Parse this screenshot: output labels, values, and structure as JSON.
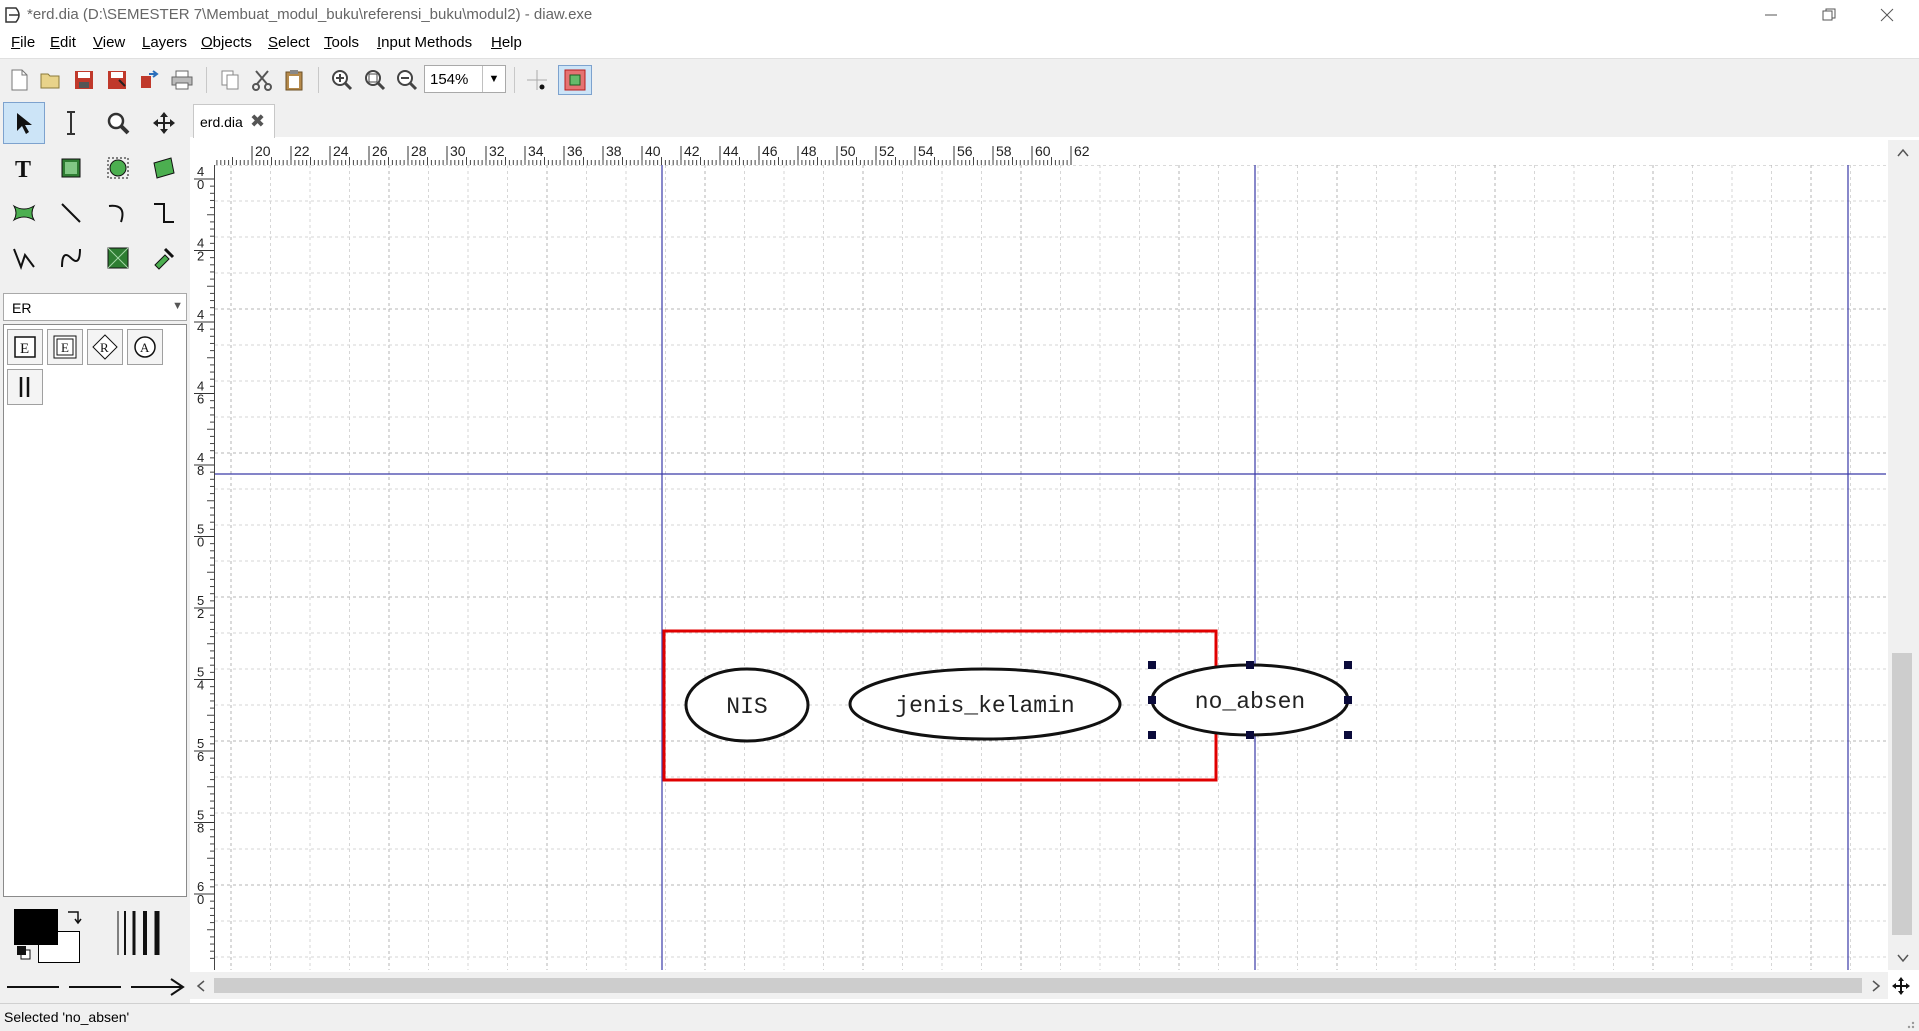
{
  "window": {
    "title": "*erd.dia (D:\\SEMESTER 7\\Membuat_modul_buku\\referensi_buku\\modul2) - diaw.exe",
    "controls": [
      "minimize",
      "restore",
      "close"
    ]
  },
  "menu": {
    "items": [
      {
        "label": "File",
        "accel": "F"
      },
      {
        "label": "Edit",
        "accel": "E"
      },
      {
        "label": "View",
        "accel": "V"
      },
      {
        "label": "Layers",
        "accel": "L"
      },
      {
        "label": "Objects",
        "accel": "O"
      },
      {
        "label": "Select",
        "accel": "S"
      },
      {
        "label": "Tools",
        "accel": "T"
      },
      {
        "label": "Input Methods",
        "accel": "I"
      },
      {
        "label": "Help",
        "accel": "H"
      }
    ]
  },
  "toolbar": {
    "zoom": "154%",
    "icons": [
      "new-icon",
      "open-icon",
      "save-icon",
      "save-as-icon",
      "export-icon",
      "print-icon",
      "copy-icon",
      "cut-icon",
      "paste-icon",
      "zoom-in-icon",
      "zoom-fit-icon",
      "zoom-out-icon",
      "snap-grid-icon",
      "snap-object-icon"
    ]
  },
  "toolbox": {
    "tools": [
      "modify",
      "text-edit",
      "magnify",
      "scroll",
      "text",
      "box",
      "ellipse",
      "polygon",
      "beziergon",
      "line",
      "arc",
      "zigzag-line",
      "polyline",
      "bezier-line",
      "image",
      "outline"
    ],
    "sheet": "ER",
    "sheet_shapes": [
      "entity",
      "weak-entity",
      "relationship",
      "attribute",
      "participation"
    ],
    "colors": {
      "foreground": "#000000",
      "background": "#ffffff"
    }
  },
  "tabs": [
    {
      "label": "erd.dia",
      "active": true
    }
  ],
  "ruler": {
    "h_labels": [
      "20",
      "22",
      "24",
      "26",
      "28",
      "30",
      "32",
      "34",
      "36",
      "38",
      "40",
      "42",
      "44",
      "46",
      "48",
      "50",
      "52",
      "54",
      "56",
      "58",
      "60",
      "62"
    ],
    "v_labels": [
      "40",
      "42",
      "44",
      "46",
      "48",
      "50",
      "52",
      "54",
      "56",
      "58",
      "60"
    ]
  },
  "diagram": {
    "attributes": [
      {
        "label": "NIS",
        "selected": false
      },
      {
        "label": "jenis_kelamin",
        "selected": false
      },
      {
        "label": "no_absen",
        "selected": true
      }
    ],
    "highlight_color": "#e00000",
    "guide_color": "#3a3aa8"
  },
  "status": {
    "text": "Selected 'no_absen'"
  }
}
